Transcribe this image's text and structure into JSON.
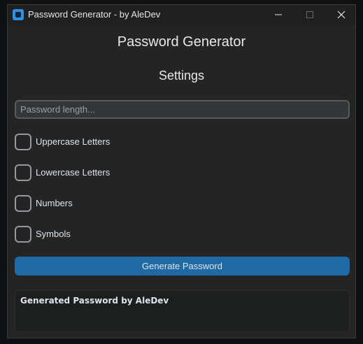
{
  "window": {
    "title": "Password Generator - by AleDev"
  },
  "app": {
    "heading": "Password Generator",
    "settings_heading": "Settings"
  },
  "length_input": {
    "placeholder": "Password length...",
    "value": ""
  },
  "options": [
    {
      "label": "Uppercase Letters",
      "checked": false
    },
    {
      "label": "Lowercase Letters",
      "checked": false
    },
    {
      "label": "Numbers",
      "checked": false
    },
    {
      "label": "Symbols",
      "checked": false
    }
  ],
  "generate_button": {
    "label": "Generate Password"
  },
  "output": {
    "text": "Generated Password by AleDev"
  },
  "colors": {
    "accent": "#1f6aa5",
    "window_bg": "#242424",
    "text": "#dce4ee"
  },
  "icons": {
    "app": "app-icon",
    "minimize": "minimize-icon",
    "maximize": "maximize-icon",
    "close": "close-icon"
  }
}
